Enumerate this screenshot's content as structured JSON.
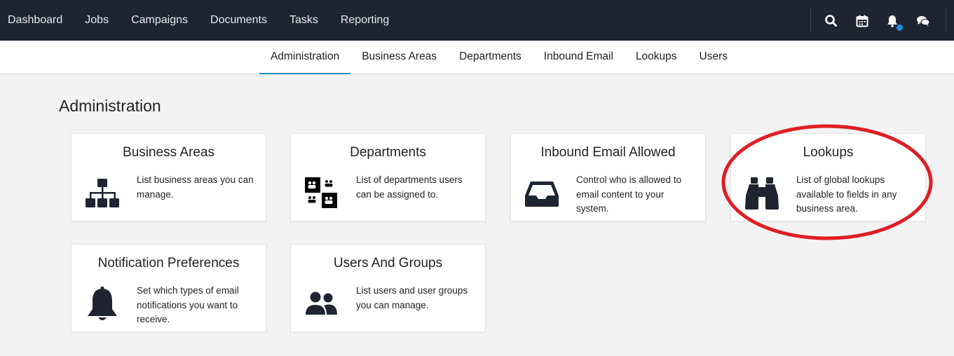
{
  "topnav": {
    "items": [
      "Dashboard",
      "Jobs",
      "Campaigns",
      "Documents",
      "Tasks",
      "Reporting"
    ],
    "icons": [
      "search-icon",
      "calendar-icon",
      "bell-icon",
      "chat-icon"
    ],
    "notification_dot_color": "#1d8fe0"
  },
  "subnav": {
    "items": [
      "Administration",
      "Business Areas",
      "Departments",
      "Inbound Email",
      "Lookups",
      "Users"
    ],
    "active": "Administration",
    "active_color": "#2a8fc8"
  },
  "page": {
    "title": "Administration"
  },
  "cards": [
    {
      "title": "Business Areas",
      "description": "List business areas you can manage.",
      "icon": "sitemap-icon"
    },
    {
      "title": "Departments",
      "description": "List of departments users can be assigned to.",
      "icon": "departments-icon"
    },
    {
      "title": "Inbound Email Allowed",
      "description": "Control who is allowed to email content to your system.",
      "icon": "inbox-icon"
    },
    {
      "title": "Lookups",
      "description": "List of global lookups available to fields in any business area.",
      "icon": "binoculars-icon"
    },
    {
      "title": "Notification Preferences",
      "description": "Set which types of email notifications you want to receive.",
      "icon": "bell-icon"
    },
    {
      "title": "Users And Groups",
      "description": "List users and user groups you can manage.",
      "icon": "users-icon"
    }
  ],
  "highlight": {
    "target": "Lookups",
    "color": "#e01e25"
  }
}
